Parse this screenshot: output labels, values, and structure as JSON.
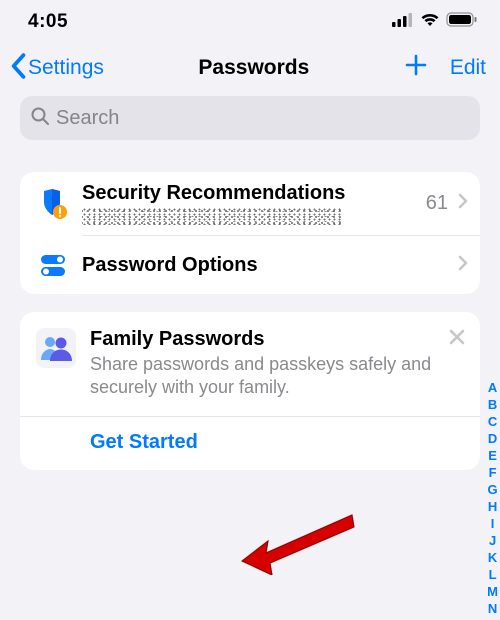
{
  "status": {
    "time": "4:05"
  },
  "nav": {
    "back": "Settings",
    "title": "Passwords",
    "edit": "Edit"
  },
  "search": {
    "placeholder": "Search"
  },
  "security": {
    "title": "Security Recommendations",
    "count": "61"
  },
  "options": {
    "title": "Password Options"
  },
  "family": {
    "title": "Family Passwords",
    "desc": "Share passwords and passkeys safely and securely with your family.",
    "action": "Get Started"
  },
  "index": [
    "A",
    "B",
    "C",
    "D",
    "E",
    "F",
    "G",
    "H",
    "I",
    "J",
    "K",
    "L",
    "M",
    "N"
  ]
}
